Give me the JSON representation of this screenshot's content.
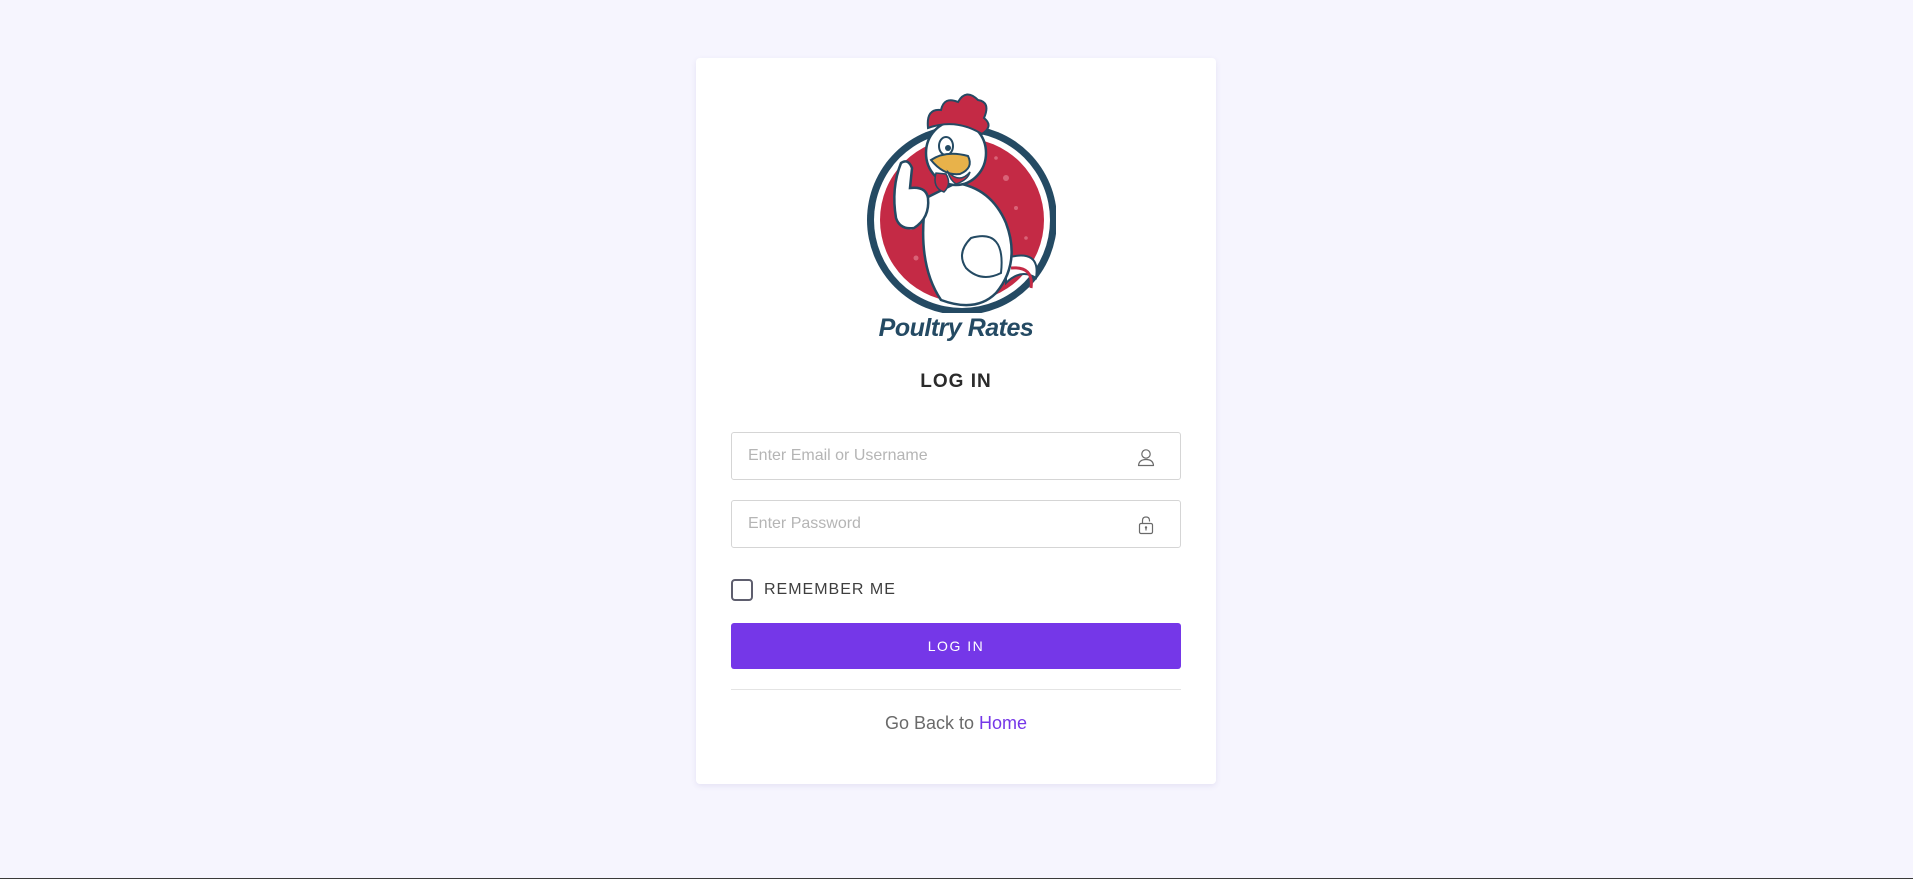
{
  "brand": {
    "name": "Poultry Rates",
    "colors": {
      "red": "#c42a45",
      "navy": "#244a63",
      "beak": "#e8b24a"
    }
  },
  "login": {
    "title": "LOG IN",
    "email": {
      "placeholder": "Enter Email or Username",
      "value": "",
      "icon": "user-icon"
    },
    "password": {
      "placeholder": "Enter Password",
      "value": "",
      "icon": "lock-icon"
    },
    "remember_label": "REMEMBER ME",
    "remember_checked": false,
    "button_label": "LOG IN"
  },
  "footer": {
    "back_text": "Go Back to",
    "home_link": "Home"
  },
  "colors": {
    "accent": "#7537e8",
    "page_background": "#f6f5fe"
  }
}
